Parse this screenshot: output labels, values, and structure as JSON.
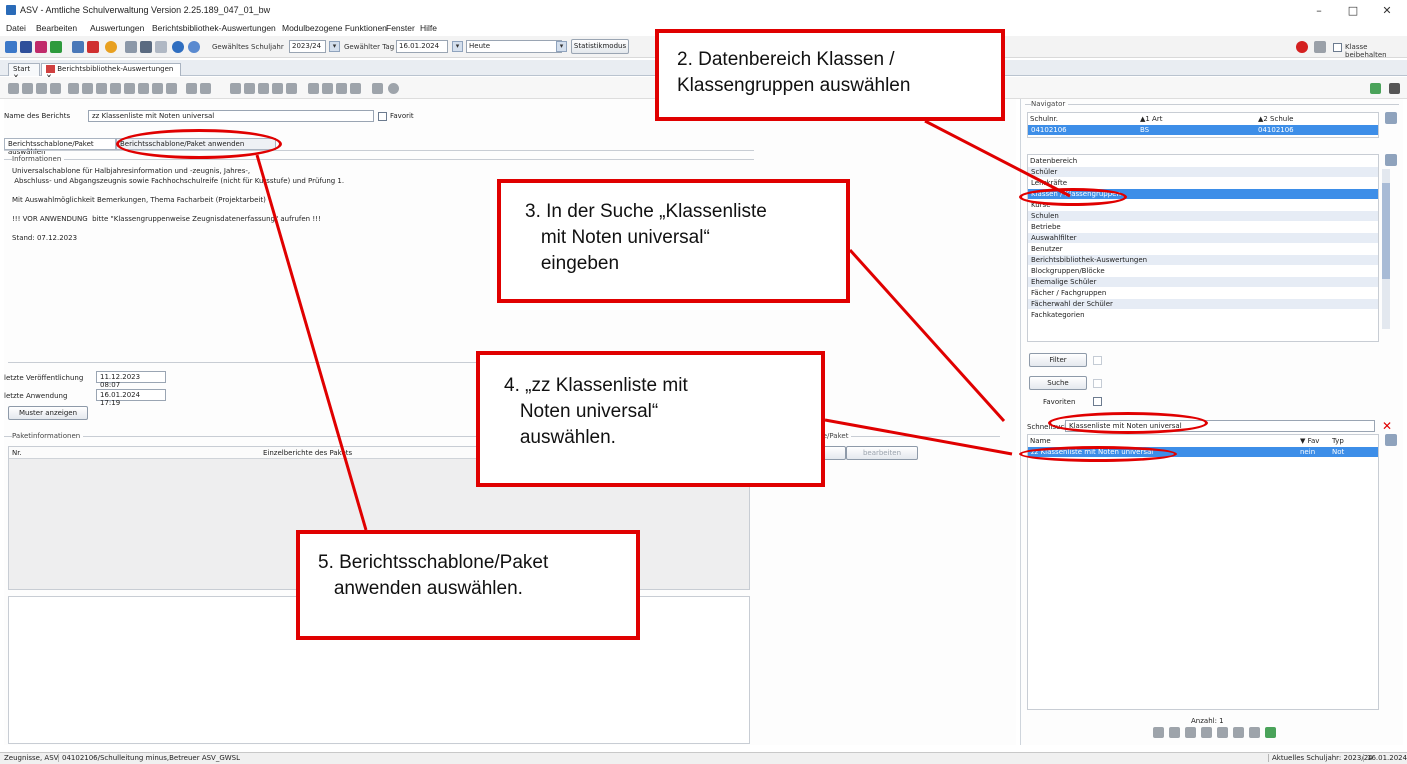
{
  "window": {
    "title": "ASV - Amtliche Schulverwaltung Version 2.25.189_047_01_bw",
    "controls": {
      "minimize": "–",
      "maximize": "□",
      "close": "✕"
    }
  },
  "menu": [
    "Datei",
    "Bearbeiten",
    "Auswertungen",
    "Berichtsbibliothek-Auswertungen",
    "Modulbezogene Funktionen",
    "Fenster",
    "Hilfe"
  ],
  "toolbar": {
    "schuljahr_label": "Gewähltes Schuljahr",
    "schuljahr_value": "2023/24",
    "tag_label": "Gewählter Tag",
    "tag_value": "16.01.2024",
    "heute_value": "Heute",
    "statistik_button": "Statistikmodus",
    "klasse_beibehalten": "Klasse beibehalten"
  },
  "tabs": [
    {
      "label": "Start",
      "close": "✕"
    },
    {
      "label": "Berichtsbibliothek-Auswertungen",
      "close": "✕"
    }
  ],
  "report": {
    "name_label": "Name des Berichts",
    "name_value": "zz Klassenliste mit Noten universal",
    "favorit_label": "Favorit",
    "subtab_select": "Berichtsschablone/Paket auswählen",
    "subtab_apply": "Berichtsschablone/Paket anwenden",
    "info_header": "Informationen",
    "info_text": "Universalschablone für Halbjahresinformation und -zeugnis, Jahres-,\n Abschluss- und Abgangszeugnis sowie Fachhochschulreife (nicht für Kursstufe) und Prüfung 1.\n\nMit Auswahlmöglichkeit Bemerkungen, Thema Facharbeit (Projektarbeit)\n\n!!! VOR ANWENDUNG  bitte \"Klassengruppenweise Zeugnisdatenerfassung\" aufrufen !!!\n\nStand: 07.12.2023",
    "letzte_veroeffentlichung_label": "letzte Veröffentlichung",
    "letzte_veroeffentlichung_value": "11.12.2023 08:07",
    "letzte_anwendung_label": "letzte Anwendung",
    "letzte_anwendung_value": "16.01.2024 17:19",
    "muster_button": "Muster anzeigen",
    "paketinfo_header": "Paketinformationen",
    "col_nr": "Nr.",
    "col_einzelberichte": "Einzelberichte des Pakets",
    "paket_group_fragment": "one/Paket",
    "bearbeiten_button": "bearbeiten"
  },
  "navigator": {
    "header": "Navigator",
    "columns": [
      "Schulnr.",
      "▲1 Art",
      "▲2 Schule"
    ],
    "row": [
      "04102106",
      "BS",
      "04102106"
    ],
    "datenbereich_header": "Datenbereich",
    "datenbereich_items": [
      "Schüler",
      "Lehrkräfte",
      "Klassen / Klassengruppen",
      "Kurse",
      "Schulen",
      "Betriebe",
      "Auswahlfilter",
      "Benutzer",
      "Berichtsbibliothek-Auswertungen",
      "Blockgruppen/Blöcke",
      "Ehemalige Schüler",
      "Fächer / Fachgruppen",
      "Fächerwahl der Schüler",
      "Fachkategorien"
    ],
    "datenbereich_selected": 2,
    "filter_button": "Filter",
    "suche_button": "Suche",
    "favoriten_label": "Favoriten",
    "schnellsuche_label": "Schnellsuche",
    "schnellsuche_value": "Klassenliste mit Noten universal",
    "result_columns": [
      "Name",
      "▼ Fav",
      "Typ"
    ],
    "result_row": [
      "zz Klassenliste mit Noten universal",
      "nein",
      "Not"
    ],
    "anzahl": "Anzahl: 1"
  },
  "statusbar": {
    "left": "Zeugnisse, ASV",
    "school": "04102106/Schulleitung minus,Betreuer ASV_GWSL",
    "right_label": "Aktuelles Schuljahr: 2023/24",
    "right_date": "16.01.2024"
  },
  "callouts": {
    "c2": "2. Datenbereich Klassen /\nKlassengruppen auswählen",
    "c3": "3. In der Suche „Klassenliste\n   mit Noten universal“\n   eingeben",
    "c4": "4. „zz Klassenliste mit\n   Noten universal“\n   auswählen.",
    "c5": "5. Berichtsschablone/Paket\n   anwenden auswählen."
  },
  "colors": {
    "annotation_red": "#e00000",
    "selection_blue": "#3d8ee8"
  }
}
